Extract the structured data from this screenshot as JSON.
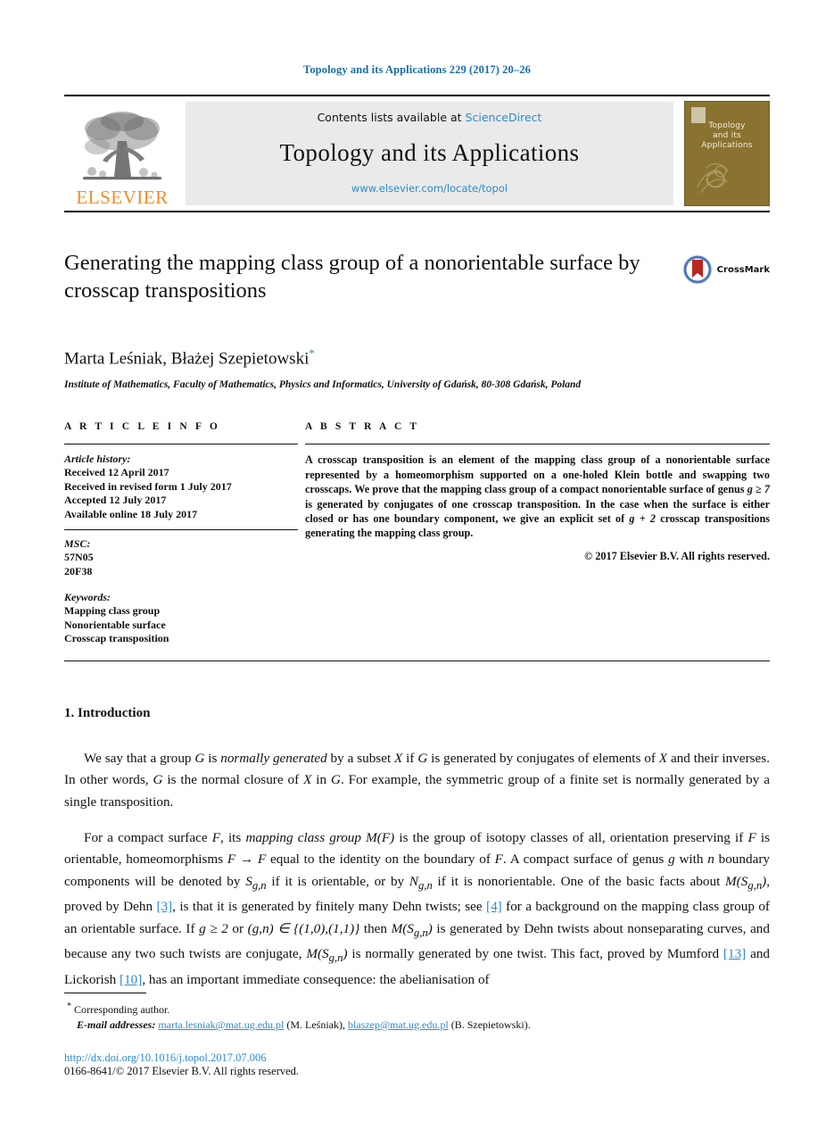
{
  "running_head": "Topology and its Applications 229 (2017) 20–26",
  "masthead": {
    "contents_prefix": "Contents lists available at ",
    "sciencedirect_link": "ScienceDirect",
    "journal_title": "Topology and its Applications",
    "journal_url": "www.elsevier.com/locate/topol",
    "publisher_logo_text": "ELSEVIER",
    "cover": {
      "line1": "Topology",
      "line2": "and its",
      "line3": "Applications",
      "color": "#8a7330"
    }
  },
  "article": {
    "title": "Generating the mapping class group of a nonorientable surface by crosscap transpositions",
    "authors": "Marta Leśniak, Błażej Szepietowski",
    "corresponding_marker": "*",
    "affiliation": "Institute of Mathematics, Faculty of Mathematics, Physics and Informatics, University of Gdańsk, 80-308 Gdańsk, Poland",
    "crossmark_label": "CrossMark"
  },
  "info": {
    "heading": "A R T I C L E    I N F O",
    "history_label": "Article history:",
    "history": [
      "Received 12 April 2017",
      "Received in revised form 1 July 2017",
      "Accepted 12 July 2017",
      "Available online 18 July 2017"
    ],
    "msc_label": "MSC:",
    "msc": [
      "57N05",
      "20F38"
    ],
    "keywords_label": "Keywords:",
    "keywords": [
      "Mapping class group",
      "Nonorientable surface",
      "Crosscap transposition"
    ]
  },
  "abstract": {
    "heading": "A B S T R A C T",
    "part1": "A crosscap transposition is an element of the mapping class group of a nonorientable surface represented by a homeomorphism supported on a one-holed Klein bottle and swapping two crosscaps. We prove that the mapping class group of a compact nonorientable surface of genus ",
    "math1": "g ≥ 7",
    "part2": " is generated by conjugates of one crosscap transposition. In the case when the surface is either closed or has one boundary component, we give an explicit set of ",
    "math2": "g + 2",
    "part3": " crosscap transpositions generating the mapping class group.",
    "copyright": "© 2017 Elsevier B.V. All rights reserved."
  },
  "body": {
    "section_number_title": "1. Introduction",
    "paragraph1": {
      "t1": "We say that a group ",
      "m1": "G",
      "t2": " is ",
      "i1": "normally generated",
      "t3": " by a subset ",
      "m2": "X",
      "t4": " if ",
      "m3": "G",
      "t5": " is generated by conjugates of elements of ",
      "m4": "X",
      "t6": " and their inverses. In other words, ",
      "m5": "G",
      "t7": " is the normal closure of ",
      "m6": "X",
      "t8": " in ",
      "m7": "G",
      "t9": ". For example, the symmetric group of a finite set is normally generated by a single transposition."
    },
    "paragraph2": {
      "t1": "For a compact surface ",
      "m1": "F",
      "t2": ", its ",
      "i1": "mapping class group",
      "t3": " ",
      "m2": "M(F)",
      "t4": " is the group of isotopy classes of all, orientation preserving if ",
      "m3": "F",
      "t5": " is orientable, homeomorphisms ",
      "m4": "F → F",
      "t6": " equal to the identity on the boundary of ",
      "m5": "F",
      "t7": ". A compact surface of genus ",
      "m6": "g",
      "t8": " with ",
      "m7": "n",
      "t9": " boundary components will be denoted by ",
      "m8": "S",
      "sub8": "g,n",
      "t10": " if it is orientable, or by ",
      "m9": "N",
      "sub9": "g,n",
      "t11": " if it is nonorientable. One of the basic facts about ",
      "m10": "M(S",
      "sub10": "g,n",
      "m10b": ")",
      "t12": ", proved by Dehn ",
      "r1": "[3]",
      "t13": ", is that it is generated by finitely many Dehn twists; see ",
      "r2": "[4]",
      "t14": " for a background on the mapping class group of an orientable surface. If ",
      "m11": "g ≥ 2",
      "t15": " or ",
      "m12": "(g,n) ∈ {(1,0),(1,1)}",
      "t16": " then ",
      "m13": "M(S",
      "sub13": "g,n",
      "m13b": ")",
      "t17": " is generated by Dehn twists about nonseparating curves, and because any two such twists are conjugate, ",
      "m14": "M(S",
      "sub14": "g,n",
      "m14b": ")",
      "t18": " is normally generated by one twist. This fact, proved by Mumford ",
      "r3": "[13]",
      "t19": " and Lickorish ",
      "r4": "[10]",
      "t20": ", has an important immediate consequence: the abelianisation of"
    }
  },
  "footnotes": {
    "corresponding_star": "*",
    "corresponding_text": "Corresponding author.",
    "email_label": "E-mail addresses:",
    "email1": "marta.lesniak@mat.ug.edu.pl",
    "email1_owner": " (M. Leśniak), ",
    "email2": "blaszep@mat.ug.edu.pl",
    "email2_owner": " (B. Szepietowski).",
    "doi": "http://dx.doi.org/10.1016/j.topol.2017.07.006",
    "issn_line": "0166-8641/© 2017 Elsevier B.V. All rights reserved."
  },
  "colors": {
    "link": "#2e8bc9",
    "running_head": "#1a6ea8",
    "elsevier_orange": "#f28c28",
    "cover_olive": "#8a7330"
  }
}
